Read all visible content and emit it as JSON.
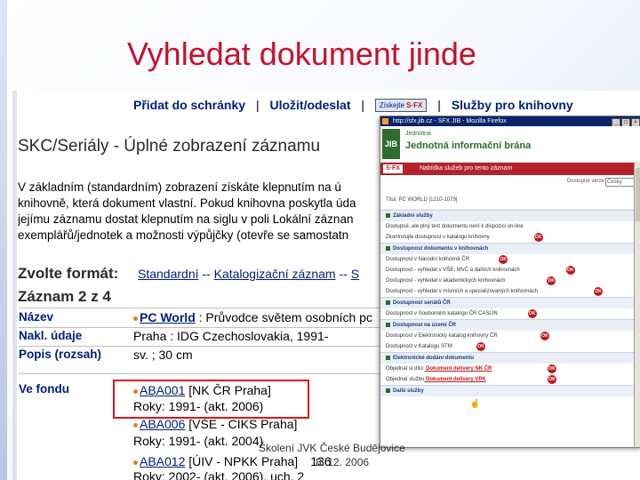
{
  "slide": {
    "title": "Vyhledat dokument jinde",
    "footer_text": "Školení JVK České Budějovice",
    "footer_date": "8. 12. 2006"
  },
  "nav": {
    "add_to_basket": "Přidat do schránky",
    "save_send": "Uložit/odeslat",
    "getit": "Získejte",
    "library_services": "Služby pro knihovny",
    "separator": "|"
  },
  "page": {
    "title": "SKC/Seriály - Úplné zobrazení záznamu",
    "intro_lines": [
      "V základním (standardním) zobrazení získáte klepnutím na ú",
      "knihovně, která dokument vlastní. Pokud knihovna poskytla úda",
      "jejímu záznamu dostat klepnutím na siglu v poli Lokální záznan",
      "exemplářů/jednotek a možnosti výpůjčky (otevře se samostatn"
    ],
    "format_label": "Zvolte formát:",
    "format_links": [
      "Standardní",
      "Katalogizační záznam",
      "S"
    ],
    "format_sep": "--",
    "record_label": "Záznam 2 z 4",
    "fields": [
      {
        "label": "Název",
        "value_link": "PC World",
        "value_rest": " : Průvodce světem osobních pc"
      },
      {
        "label": "Nakl. údaje",
        "value_text": "Praha : IDG Czechoslovakia, 1991-"
      },
      {
        "label": "Popis (rozsah)",
        "value_text": "sv. ; 30 cm"
      }
    ],
    "holdings_label": "Ve fondu",
    "holdings": [
      {
        "link": "ABA001",
        "rest": " [NK ČR Praha]",
        "years": "Roky: 1991- (akt. 2006)"
      },
      {
        "link": "ABA006",
        "rest": " [VŠE - CIKS Praha]",
        "years": "Roky: 1991- (akt. 2004)"
      },
      {
        "link": "ABA012",
        "rest": " [ÚIV - NPKK Praha]",
        "years": "Roky: 2002- (akt. 2006), uch. 2"
      }
    ],
    "partial_number": "136"
  },
  "sfx_popup": {
    "window_title": "http://sfx.jib.cz - SFX JIB - Mozilla Firefox",
    "banner_small": "JIB",
    "banner_line1": "Jednotná",
    "banner_line2": "Jednotná informační brána",
    "sfx_logo": "S·FX",
    "sfx_title": "Nabídka služeb pro tento záznam",
    "language_label": "Dostupné verze",
    "language_value": "Česky",
    "citation": "Titul: PC WORLD [1210-1079]",
    "items": [
      {
        "type": "header",
        "text": "Základní služby"
      },
      {
        "type": "item",
        "text": "Dostupné, ale plný text dokumentu není k dispozici on-line"
      },
      {
        "type": "item",
        "text": "Zkontrolujte dostupnost v katalogu knihovny",
        "ok": true
      },
      {
        "type": "header",
        "text": "Dostupnost dokumentu v knihovnách"
      },
      {
        "type": "item",
        "text": "Dostupnost v Národní knihovně ČR",
        "ok": true
      },
      {
        "type": "item",
        "text": "Dostupnost - vyhledat v VŠE, MVČ a dalších knihovnách",
        "ok": true
      },
      {
        "type": "item",
        "text": "Dostupnost - vyhledat v akademických knihovnách",
        "ok": true
      },
      {
        "type": "item",
        "text": "Dostupnost - vyhledat v místních a specializovaných knihovnách",
        "ok": true
      },
      {
        "type": "header",
        "text": "Dostupnost seriálů ČR"
      },
      {
        "type": "item",
        "text": "Dostupnost v Souborném katalogu ČR CASLIN",
        "ok": true
      },
      {
        "type": "header",
        "text": "Dostupnost na území ČR"
      },
      {
        "type": "item",
        "text": "Dostupnost v Elektronický katalog knihovny ČR",
        "ok": true
      },
      {
        "type": "item",
        "text": "Dostupnost v Katalogu STM",
        "ok": true
      },
      {
        "type": "header",
        "text": "Elektronické dodání dokumentu"
      },
      {
        "type": "item",
        "text": "Objednat si dílo:",
        "link": "Dokument delivery NK ČR",
        "ok": true
      },
      {
        "type": "item",
        "text": "Objednat službu",
        "link": "Dokument delivery VPK",
        "ok": true
      },
      {
        "type": "header",
        "text": "Další služby"
      }
    ],
    "ok_label": "OK"
  },
  "colors": {
    "title_red": "#c8102e",
    "link_blue": "#00207a",
    "highlight_box": "#e0141c",
    "sfx_red": "#b5222a"
  }
}
